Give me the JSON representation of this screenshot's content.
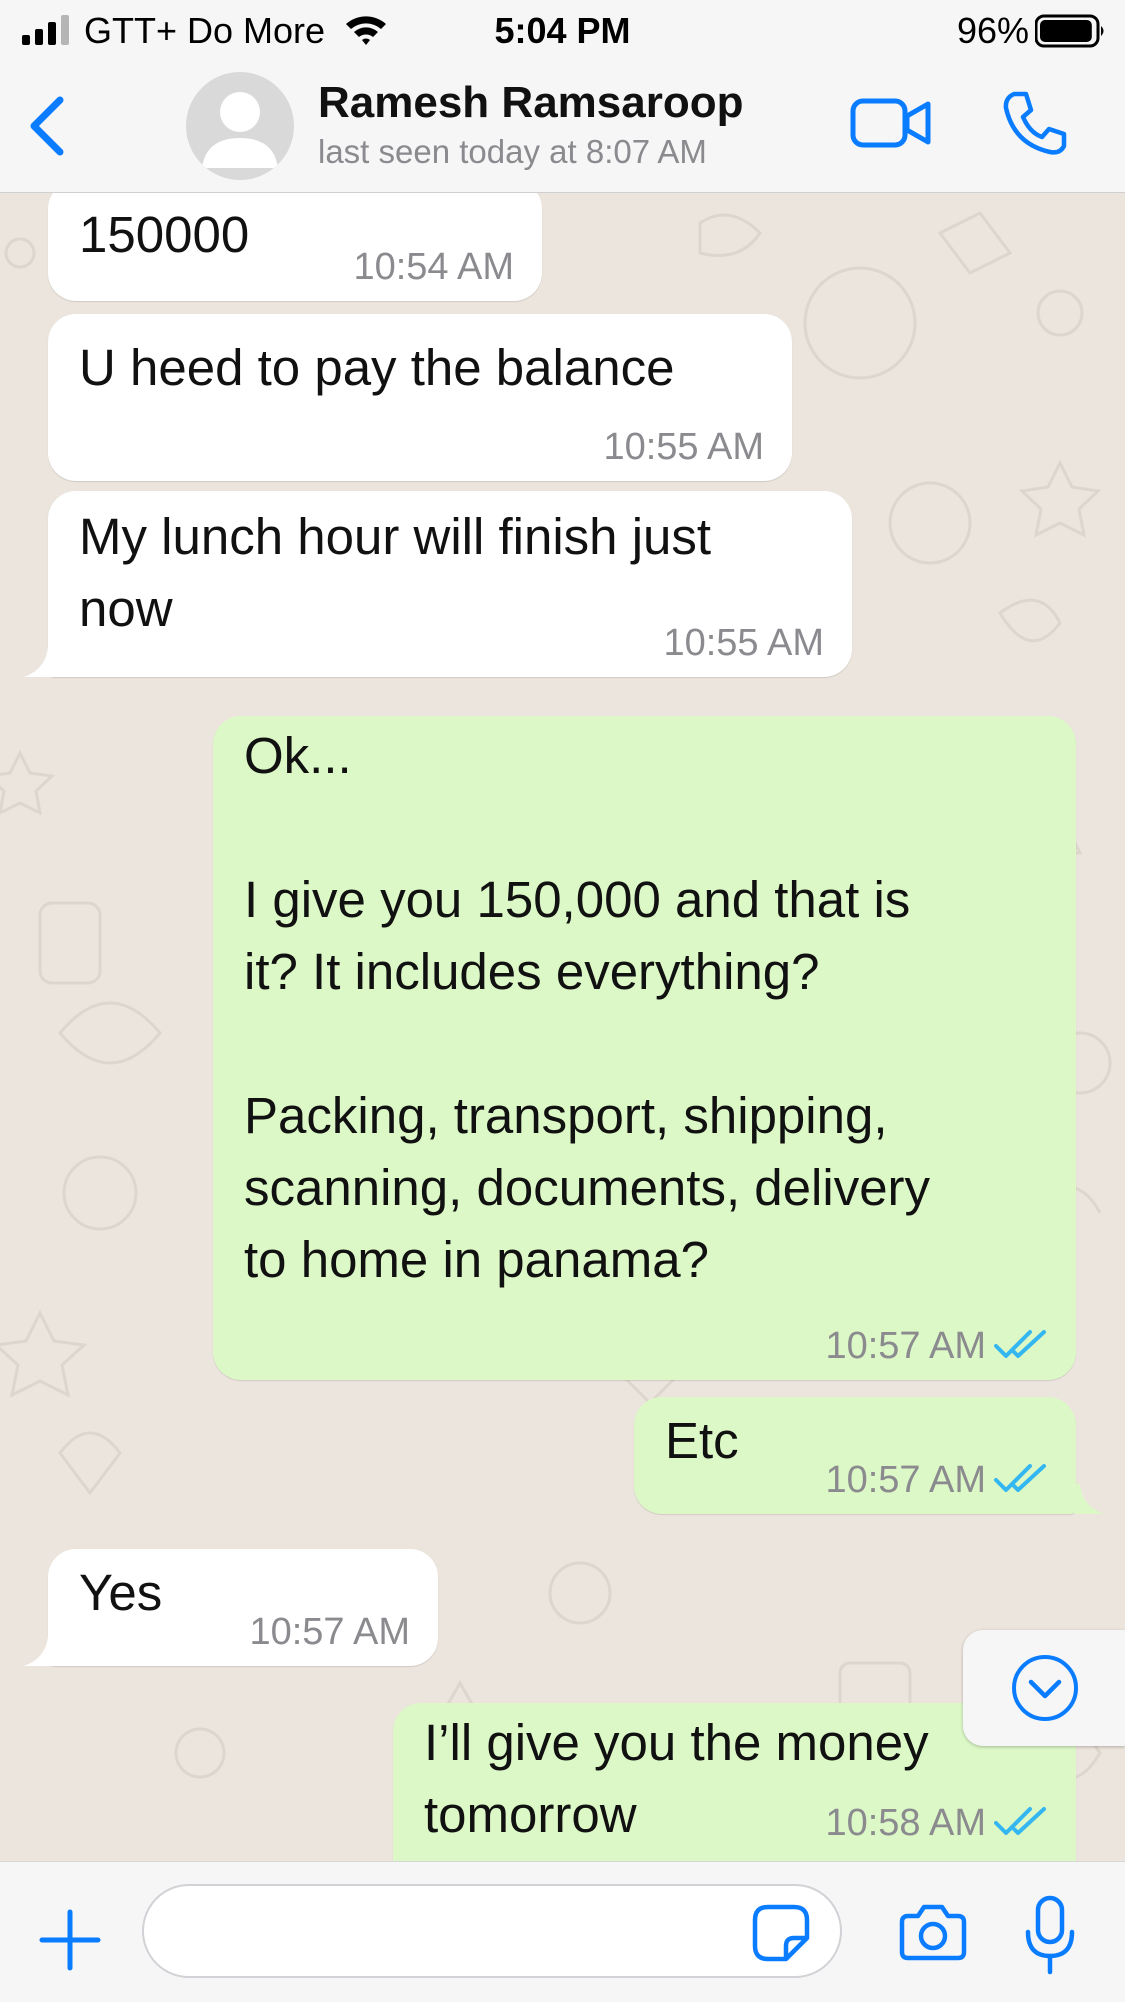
{
  "status_bar": {
    "carrier": "GTT+ Do More",
    "time": "5:04 PM",
    "battery_percent": "96%",
    "battery_level": 0.96
  },
  "header": {
    "contact_name": "Ramesh Ramsaroop",
    "last_seen": "last seen today at 8:07 AM"
  },
  "messages": [
    {
      "direction": "incoming",
      "text": "150000",
      "time": "10:54 AM"
    },
    {
      "direction": "incoming",
      "text": "U heed to pay the balance",
      "time": "10:55 AM"
    },
    {
      "direction": "incoming",
      "text": "My lunch hour will finish just\nnow",
      "time": "10:55 AM"
    },
    {
      "direction": "outgoing",
      "text": "Ok...\n\nI give you 150,000 and that is\nit? It includes everything?\n\nPacking, transport, shipping,\nscanning, documents, delivery\nto home in panama?",
      "time": "10:57 AM",
      "status": "read"
    },
    {
      "direction": "outgoing",
      "text": "Etc",
      "time": "10:57 AM",
      "status": "read"
    },
    {
      "direction": "incoming",
      "text": "Yes",
      "time": "10:57 AM"
    },
    {
      "direction": "outgoing",
      "text": "I’ll give you the money\ntomorrow",
      "time": "10:58 AM",
      "status": "read"
    }
  ],
  "input": {
    "value": "",
    "placeholder": ""
  },
  "icons": {
    "back": "chevron-left-icon",
    "video": "video-camera-icon",
    "call": "phone-icon",
    "plus": "plus-icon",
    "sticker": "sticker-icon",
    "camera": "camera-icon",
    "mic": "microphone-icon",
    "scroll_down": "chevron-down-circle-icon"
  },
  "colors": {
    "accent": "#0a7cff",
    "outgoing_bubble": "#dcf8c6",
    "incoming_bubble": "#ffffff",
    "chat_background": "#ece5dd",
    "read_ticks": "#34b7f1"
  }
}
